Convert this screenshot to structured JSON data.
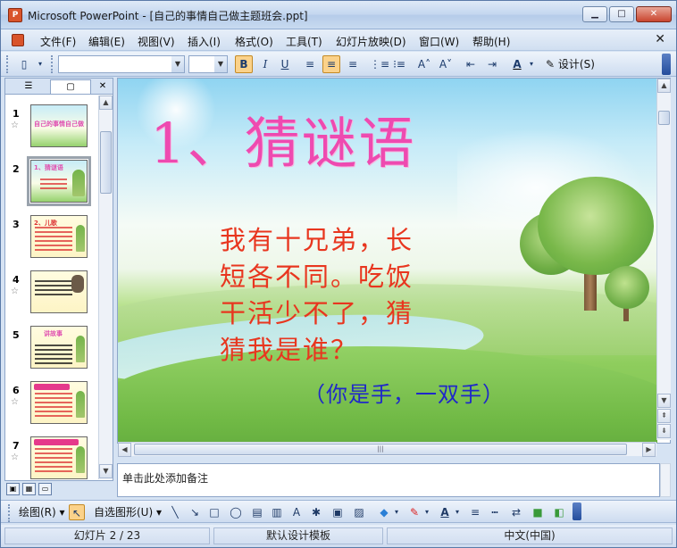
{
  "window": {
    "app_name": "Microsoft PowerPoint",
    "title": "Microsoft PowerPoint - [自己的事情自己做主题班会.ppt]",
    "minimize": "▁",
    "maximize": "□",
    "close": "✕"
  },
  "menu": {
    "items": [
      "文件(F)",
      "编辑(E)",
      "视图(V)",
      "插入(I)",
      "格式(O)",
      "工具(T)",
      "幻灯片放映(D)",
      "窗口(W)",
      "帮助(H)"
    ],
    "close": "✕"
  },
  "toolbar": {
    "font_name": "",
    "font_size": "",
    "bold": "B",
    "italic": "I",
    "underline": "U",
    "design_label": "设计(S)"
  },
  "left_pane": {
    "tabs": {
      "outline": "☰",
      "slides": "▢",
      "close": "✕"
    },
    "selected_slide": 2,
    "thumbnails": [
      {
        "num": "1",
        "star": "☆",
        "title": "自己的事情自己做"
      },
      {
        "num": "2",
        "star": "",
        "title": "1、猜谜语"
      },
      {
        "num": "3",
        "star": "",
        "title": "2、儿歌"
      },
      {
        "num": "4",
        "star": "☆",
        "title": ""
      },
      {
        "num": "5",
        "star": "",
        "title": "讲故事"
      },
      {
        "num": "6",
        "star": "☆",
        "title": ""
      },
      {
        "num": "7",
        "star": "☆",
        "title": ""
      }
    ]
  },
  "slide": {
    "title": "1、猜谜语",
    "riddle": [
      "我有十兄弟，长",
      "短各不同。吃饭",
      "干活少不了，猜",
      "猜我是谁？"
    ],
    "answer": "（你是手，一双手）"
  },
  "notes": {
    "placeholder": "单击此处添加备注"
  },
  "drawing_toolbar": {
    "draw": "绘图(R)",
    "autoshapes": "自选图形(U)"
  },
  "statusbar": {
    "slide_info": "幻灯片 2 / 23",
    "design": "默认设计模板",
    "language": "中文(中国)"
  }
}
